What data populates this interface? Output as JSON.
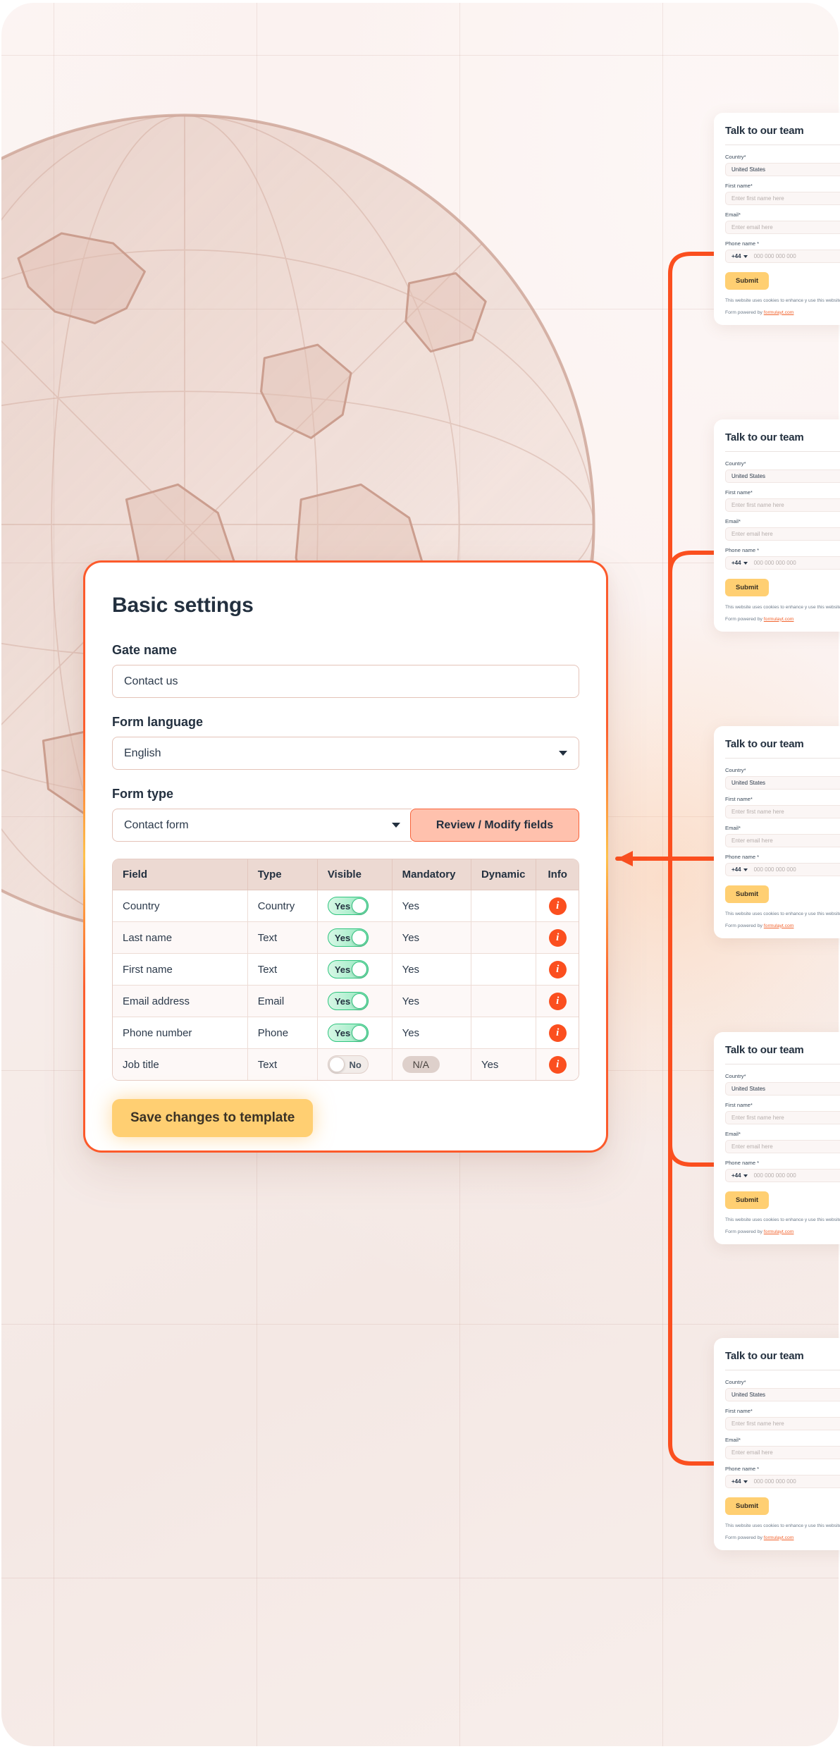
{
  "settings_card": {
    "title": "Basic settings",
    "gate_name": {
      "label": "Gate name",
      "value": "Contact us"
    },
    "form_language": {
      "label": "Form language",
      "value": "English"
    },
    "form_type": {
      "label": "Form type",
      "value": "Contact form"
    },
    "review_button": "Review / Modify fields",
    "save_button": "Save changes to template",
    "table": {
      "headers": [
        "Field",
        "Type",
        "Visible",
        "Mandatory",
        "Dynamic",
        "Info"
      ],
      "rows": [
        {
          "field": "Country",
          "type": "Country",
          "visible": "Yes",
          "visible_on": true,
          "mandatory": "Yes",
          "mandatory_pill": false,
          "dynamic": "",
          "info": "i"
        },
        {
          "field": "Last name",
          "type": "Text",
          "visible": "Yes",
          "visible_on": true,
          "mandatory": "Yes",
          "mandatory_pill": false,
          "dynamic": "",
          "info": "i"
        },
        {
          "field": "First name",
          "type": "Text",
          "visible": "Yes",
          "visible_on": true,
          "mandatory": "Yes",
          "mandatory_pill": false,
          "dynamic": "",
          "info": "i"
        },
        {
          "field": "Email address",
          "type": "Email",
          "visible": "Yes",
          "visible_on": true,
          "mandatory": "Yes",
          "mandatory_pill": false,
          "dynamic": "",
          "info": "i"
        },
        {
          "field": "Phone number",
          "type": "Phone",
          "visible": "Yes",
          "visible_on": true,
          "mandatory": "Yes",
          "mandatory_pill": false,
          "dynamic": "",
          "info": "i"
        },
        {
          "field": "Job title",
          "type": "Text",
          "visible": "No",
          "visible_on": false,
          "mandatory": "N/A",
          "mandatory_pill": true,
          "dynamic": "Yes",
          "info": "i"
        }
      ]
    }
  },
  "form_preview": {
    "title": "Talk to our team",
    "country_label": "Country*",
    "country_value": "United States",
    "first_name_label": "First name*",
    "first_name_placeholder": "Enter first name here",
    "email_label": "Email*",
    "email_placeholder": "Enter email here",
    "phone_label": "Phone name *",
    "phone_country_code": "+44",
    "phone_placeholder": "000 000 000 000",
    "submit_label": "Submit",
    "cookie_notice": "This website uses cookies to enhance y use this website we'll assume that you the site.",
    "powered_prefix": "Form powered by ",
    "powered_link": "formulayt.com"
  },
  "colors": {
    "accent_orange": "#fb4f1f",
    "accent_yellow": "#ffcf72",
    "toggle_green": "#2fc47e",
    "border_pink": "#e4c3b8",
    "text_dark": "#23303f"
  }
}
